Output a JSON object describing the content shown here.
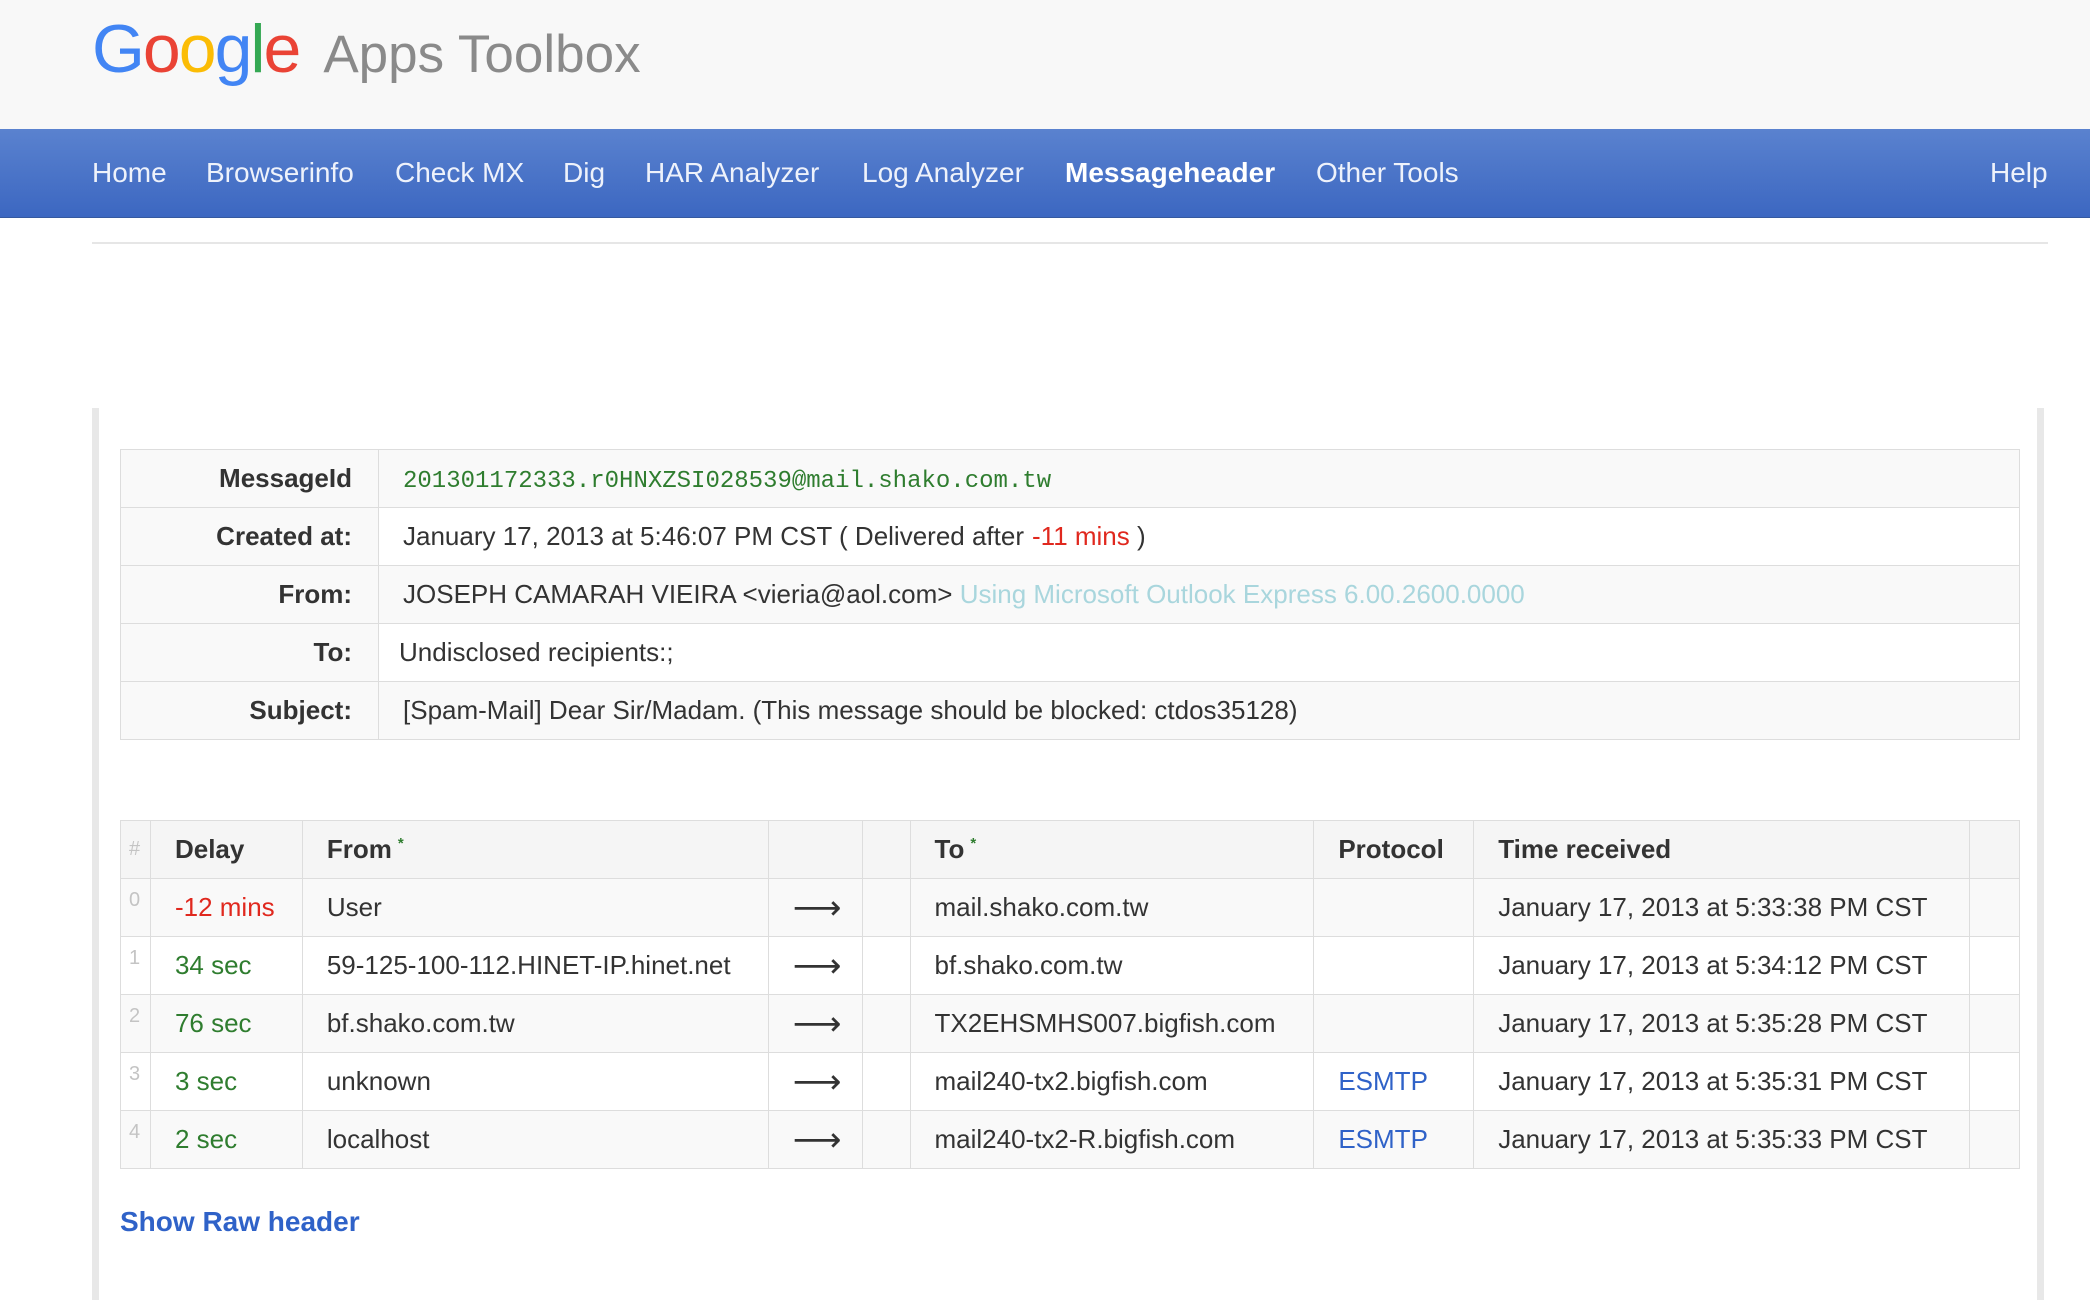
{
  "app": {
    "logo_letters": [
      {
        "char": "G",
        "color": "#4285F4"
      },
      {
        "char": "o",
        "color": "#EA4335"
      },
      {
        "char": "o",
        "color": "#FBBC05"
      },
      {
        "char": "g",
        "color": "#4285F4"
      },
      {
        "char": "l",
        "color": "#34A853"
      },
      {
        "char": "e",
        "color": "#EA4335"
      }
    ],
    "title": "Apps Toolbox"
  },
  "nav": {
    "items": [
      {
        "label": "Home"
      },
      {
        "label": "Browserinfo"
      },
      {
        "label": "Check MX"
      },
      {
        "label": "Dig"
      },
      {
        "label": "HAR Analyzer"
      },
      {
        "label": "Log Analyzer"
      },
      {
        "label": "Messageheader",
        "active": true
      },
      {
        "label": "Other Tools"
      }
    ],
    "help": "Help"
  },
  "summary": {
    "message_id_label": "MessageId",
    "message_id": "201301172333.r0HNXZSI028539@mail.shako.com.tw",
    "created_label": "Created at:",
    "created_value": "January 17, 2013 at 5:46:07 PM CST",
    "delivered_prefix": "( Delivered after",
    "delivered_delay": "-11 mins",
    "delivered_suffix": ")",
    "from_label": "From:",
    "from_value": "JOSEPH CAMARAH VIEIRA <vieria@aol.com>",
    "from_client": "Using Microsoft Outlook Express 6.00.2600.0000",
    "to_label": "To:",
    "to_value": "Undisclosed recipients:;",
    "subject_label": "Subject:",
    "subject_value": "[Spam-Mail] Dear Sir/Madam. (This message should be blocked: ctdos35128)"
  },
  "hops": {
    "columns": {
      "num": "#",
      "delay": "Delay",
      "from": "From",
      "from_marker": "*",
      "to": "To",
      "to_marker": "*",
      "protocol": "Protocol",
      "time": "Time received"
    },
    "arrow": "⟶",
    "rows": [
      {
        "num": "0",
        "delay": "-12 mins",
        "delay_color": "#e0281e",
        "from": "User",
        "to": "mail.shako.com.tw",
        "protocol": "",
        "time": "January 17, 2013 at 5:33:38 PM CST"
      },
      {
        "num": "1",
        "delay": "34 sec",
        "delay_color": "#2f7d2f",
        "from": "59-125-100-112.HINET-IP.hinet.net",
        "to": "bf.shako.com.tw",
        "protocol": "",
        "time": "January 17, 2013 at 5:34:12 PM CST"
      },
      {
        "num": "2",
        "delay": "76 sec",
        "delay_color": "#2f7d2f",
        "from": "bf.shako.com.tw",
        "to": "TX2EHSMHS007.bigfish.com",
        "protocol": "",
        "time": "January 17, 2013 at 5:35:28 PM CST"
      },
      {
        "num": "3",
        "delay": "3 sec",
        "delay_color": "#2f7d2f",
        "from": "unknown",
        "to": "mail240-tx2.bigfish.com",
        "protocol": "ESMTP",
        "time": "January 17, 2013 at 5:35:31 PM CST"
      },
      {
        "num": "4",
        "delay": "2 sec",
        "delay_color": "#2f7d2f",
        "from": "localhost",
        "to": "mail240-tx2-R.bigfish.com",
        "protocol": "ESMTP",
        "time": "January 17, 2013 at 5:35:33 PM CST"
      }
    ]
  },
  "raw_header_link": "Show Raw header"
}
